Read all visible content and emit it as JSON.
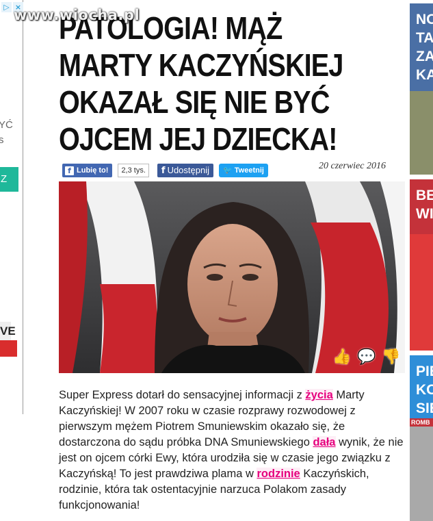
{
  "watermark": "www.wiocha.pl",
  "left_ad": {
    "adchoices": [
      "▷",
      "×"
    ],
    "text_lines": [
      "YĆ",
      "s"
    ],
    "button_label": "Z",
    "dark_label": "VE"
  },
  "article": {
    "title": "PATOLOGIA! MĄŻ MARTY KACZYŃSKIEJ OKAZAŁ SIĘ NIE BYĆ OJCEM JEJ DZIECKA!",
    "date": "20 czerwiec 2016",
    "social": {
      "like_label": "Lubię to!",
      "like_count": "2,3 tys.",
      "share_label": "Udostępnij",
      "tweet_label": "Tweetnij"
    },
    "hero_actions": [
      "like-hand-icon",
      "comment-icon",
      "dislike-hand-icon"
    ],
    "body": {
      "p1": "Super Express dotarł do sensacyjnej informacji z ",
      "link1": "życia",
      "p2": " Marty Kaczyńskiej! W 2007 roku w czasie rozprawy rozwodowej z pierwszym mężem Piotrem Smuniewskim okazało się, że dostarczona do sądu próbka DNA Smuniewskiego ",
      "link2": "dała",
      "p3": " wynik, że nie jest on ojcem córki Ewy, która urodziła się w czasie jego związku z Kaczyńską! To jest prawdziwa plama w ",
      "link3": "rodzinie",
      "p4": " Kaczyńskich, rodzinie, która tak ostentacyjnie narzuca Polakom zasady funkcjonowania!"
    }
  },
  "right_col": {
    "block1_lines": [
      "NO",
      "TA",
      "ZA",
      "KA"
    ],
    "block2_lines": [
      "BE",
      "WI"
    ],
    "block3_lines": [
      "PIE",
      "KO",
      "SIE"
    ],
    "block3_tag": "ROMB"
  },
  "colors": {
    "accent": "#e6007e",
    "facebook": "#3b5998",
    "twitter": "#1da1f2",
    "teal": "#1fb89a",
    "red": "#d92d2d"
  }
}
